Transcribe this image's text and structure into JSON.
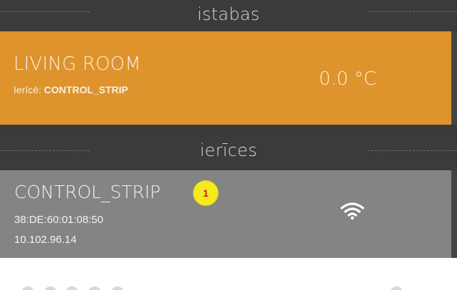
{
  "sections": {
    "rooms_title": "istabas",
    "devices_title": "ierīces"
  },
  "room": {
    "name": "LIVING ROOM",
    "device_prefix": "Ierīcē: ",
    "device_name": "CONTROL_STRIP",
    "temperature": "0.0 °C",
    "color": "#de932d"
  },
  "device": {
    "name": "CONTROL_STRIP",
    "mac": "38:DE:60:01:08:50",
    "ip": "10.102.96.14",
    "badge": "1",
    "status_icon": "wifi-icon",
    "color": "#848484"
  }
}
